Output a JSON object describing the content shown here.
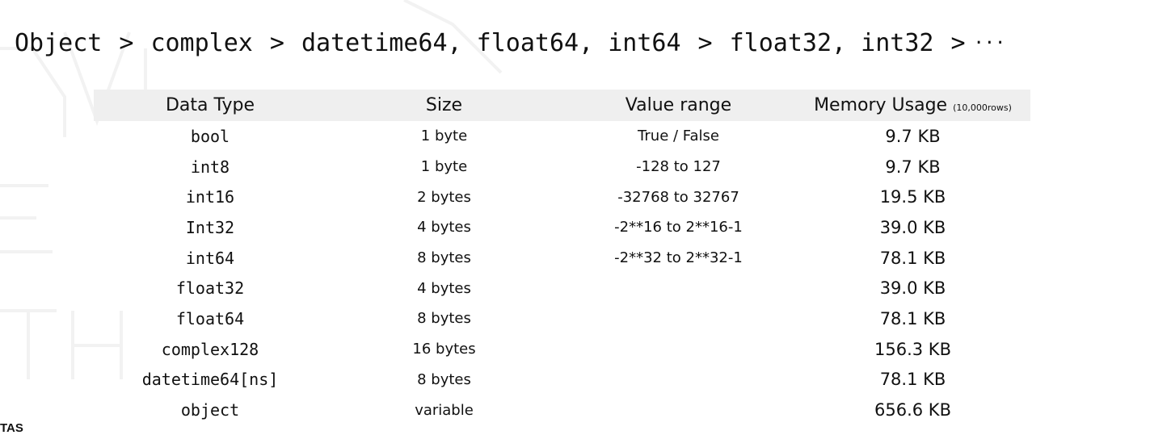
{
  "breadcrumb": {
    "items": [
      "Object",
      "complex",
      "datetime64, float64, int64",
      "float32, int32",
      "···"
    ],
    "separator": ">"
  },
  "corner_text": "TAS",
  "table": {
    "headers": {
      "type": "Data Type",
      "size": "Size",
      "range": "Value range",
      "memory": "Memory Usage",
      "memory_note": "(10,000rows)"
    },
    "rows": [
      {
        "type": "bool",
        "size": "1 byte",
        "range": "True / False",
        "memory": "9.7 KB"
      },
      {
        "type": "int8",
        "size": "1 byte",
        "range": "-128 to 127",
        "memory": "9.7 KB"
      },
      {
        "type": "int16",
        "size": "2 bytes",
        "range": "-32768 to 32767",
        "memory": "19.5 KB"
      },
      {
        "type": "Int32",
        "size": "4 bytes",
        "range": "-2**16 to 2**16-1",
        "memory": "39.0 KB"
      },
      {
        "type": "int64",
        "size": "8 bytes",
        "range": "-2**32 to 2**32-1",
        "memory": "78.1 KB"
      },
      {
        "type": "float32",
        "size": "4 bytes",
        "range": "",
        "memory": "39.0 KB"
      },
      {
        "type": "float64",
        "size": "8 bytes",
        "range": "",
        "memory": "78.1 KB"
      },
      {
        "type": "complex128",
        "size": "16 bytes",
        "range": "",
        "memory": "156.3 KB"
      },
      {
        "type": "datetime64[ns]",
        "size": "8 bytes",
        "range": "",
        "memory": "78.1 KB"
      },
      {
        "type": "object",
        "size": "variable",
        "range": "",
        "memory": "656.6 KB"
      }
    ]
  },
  "colors": {
    "header_bg": "#efefef",
    "text": "#111111",
    "watermark": "#f3f3f3"
  }
}
